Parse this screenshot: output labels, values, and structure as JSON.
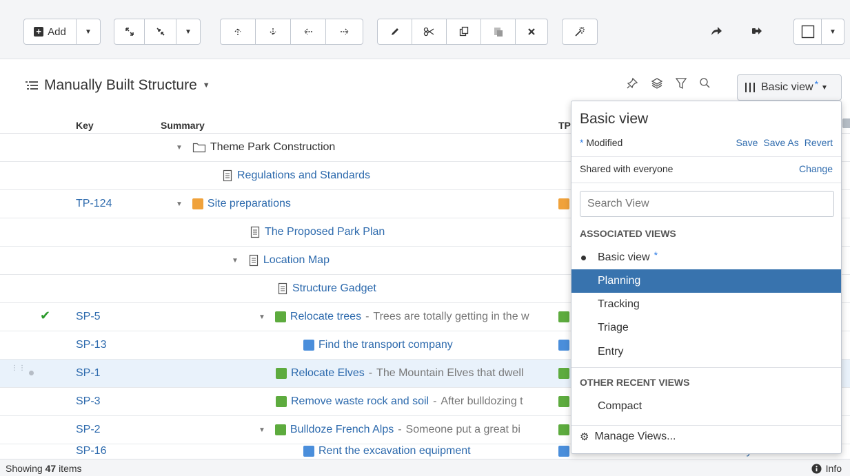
{
  "toolbar": {
    "add_label": "Add"
  },
  "structure": {
    "title": "Manually Built Structure"
  },
  "view_button": {
    "label": "Basic view",
    "modified_mark": "*"
  },
  "table": {
    "headers": {
      "key": "Key",
      "summary": "Summary",
      "tp": "TP"
    },
    "rows": [
      {
        "key": "",
        "summary": "Theme Park Construction",
        "desc": ""
      },
      {
        "key": "",
        "summary": "Regulations and Standards",
        "desc": ""
      },
      {
        "key": "TP-124",
        "summary": "Site preparations",
        "desc": ""
      },
      {
        "key": "",
        "summary": "The Proposed Park Plan",
        "desc": ""
      },
      {
        "key": "",
        "summary": "Location Map",
        "desc": ""
      },
      {
        "key": "",
        "summary": "Structure Gadget",
        "desc": ""
      },
      {
        "key": "SP-5",
        "summary": "Relocate trees",
        "desc": "Trees are totally getting in the w"
      },
      {
        "key": "SP-13",
        "summary": "Find the transport company",
        "desc": ""
      },
      {
        "key": "SP-1",
        "summary": "Relocate Elves",
        "desc": "The Mountain Elves that dwell"
      },
      {
        "key": "SP-3",
        "summary": "Remove waste rock and soil",
        "desc": "After bulldozing t"
      },
      {
        "key": "SP-2",
        "summary": "Bulldoze French Alps",
        "desc": "Someone put a great bi"
      },
      {
        "key": "SP-16",
        "summary": "Rent the excavation equipment",
        "desc": ""
      }
    ],
    "partial_assignee": "M. Reynolds"
  },
  "status": {
    "showing_prefix": "Showing",
    "count": "47",
    "showing_suffix": "items",
    "info_label": "Info"
  },
  "dropdown": {
    "title": "Basic view",
    "modified_mark": "*",
    "modified_label": "Modified",
    "save": "Save",
    "save_as": "Save As",
    "revert": "Revert",
    "shared": "Shared with everyone",
    "change": "Change",
    "search_placeholder": "Search View",
    "associated_header": "ASSOCIATED VIEWS",
    "associated": [
      "Basic view",
      "Planning",
      "Tracking",
      "Triage",
      "Entry"
    ],
    "other_header": "OTHER RECENT VIEWS",
    "other": [
      "Compact"
    ],
    "manage": "Manage Views..."
  }
}
